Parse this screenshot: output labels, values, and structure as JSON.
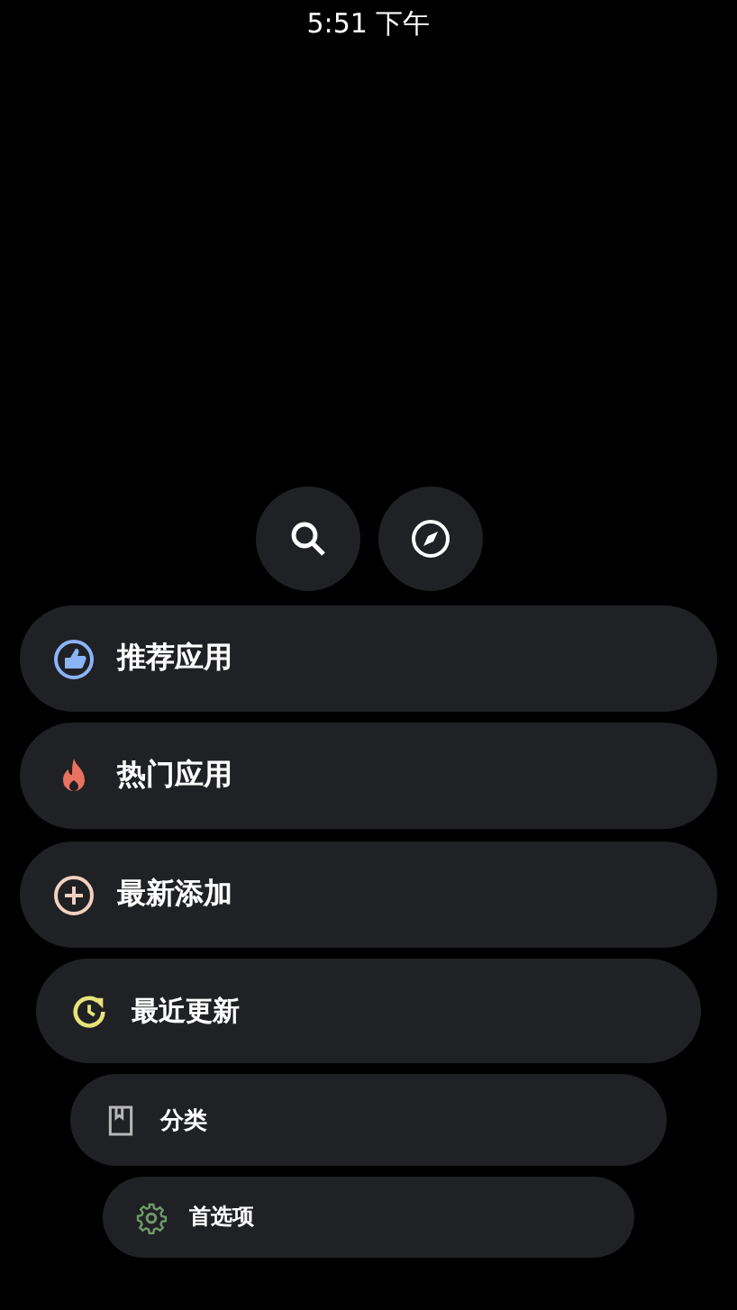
{
  "status_bar": {
    "time": "5:51 下午"
  },
  "quick_actions": [
    {
      "kind": "search"
    },
    {
      "kind": "compass"
    }
  ],
  "menu": [
    {
      "label": "推荐应用",
      "kind": "thumb",
      "color": "#8ab4f8"
    },
    {
      "label": "热门应用",
      "kind": "fire",
      "color": "#e8715f"
    },
    {
      "label": "最新添加",
      "kind": "plus",
      "color": "#f2d0c0"
    },
    {
      "label": "最近更新",
      "kind": "refresh",
      "color": "#e6e37a"
    },
    {
      "label": "分类",
      "kind": "book",
      "color": "#b8b8b8"
    },
    {
      "label": "首选项",
      "kind": "gear",
      "color": "#6f9a6a"
    }
  ]
}
